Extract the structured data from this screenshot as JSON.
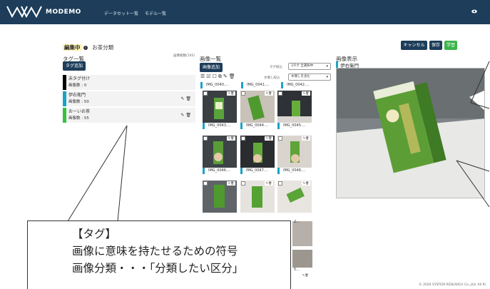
{
  "nav": {
    "logo_text": "MODEMO",
    "links": [
      "データセット一覧",
      "モデル一覧"
    ]
  },
  "edit": {
    "status": "編集中",
    "info_icon": "info-icon",
    "name": "お茶分類"
  },
  "actions": {
    "cancel": "キャンセル",
    "save": "保存",
    "train": "学習"
  },
  "tags": {
    "title": "タグ一覧",
    "total": "画像総数(105)",
    "add_button": "タグ追加",
    "items": [
      {
        "name": "未タグ付け",
        "count": "画像数 : 0",
        "color": "#000000"
      },
      {
        "name": "伊右衛門",
        "count": "画像数 : 50",
        "color": "#1ba3c6"
      },
      {
        "name": "おーいお茶",
        "count": "画像数 : 55",
        "color": "#35c23d"
      }
    ]
  },
  "images": {
    "title": "画像一覧",
    "add_button": "画像追加",
    "tag_filter_label": "タグ絞込",
    "tag_filter_value": "3タグ 全選択中",
    "water_filter_label": "水増し絞込",
    "water_filter_value": "水増しを含む",
    "captions": [
      "IMG_0040....",
      "IMG_0041....",
      "IMG_0042....",
      "IMG_0043....",
      "IMG_0044....",
      "IMG_0045....",
      "IMG_0046....",
      "IMG_0047....",
      "IMG_0048....",
      "2...",
      "5..."
    ]
  },
  "preview": {
    "title": "画像表示",
    "tag": "伊右衛門"
  },
  "callout": {
    "lines": [
      "【タグ】",
      "画像に意味を持たせるための符号",
      "画像分類・・・「分類したい区分」"
    ]
  },
  "footer": "© 2020 SYSTEM RESEARCH Co.,Ltd. All Ri",
  "colors": {
    "nav": "#1d3d5a",
    "green": "#3bb54a",
    "tag_blue": "#1ba3c6",
    "tag_green": "#35c23d"
  }
}
